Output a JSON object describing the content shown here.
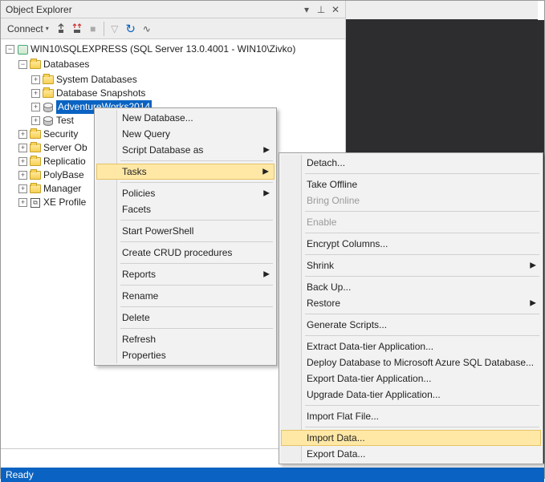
{
  "panel": {
    "title": "Object Explorer",
    "connect_label": "Connect"
  },
  "icons": {
    "window_dropdown": "▾",
    "pin": "📌",
    "close": "✕",
    "refresh": "↻",
    "filter": "▽",
    "pulse": "⁓"
  },
  "tree": {
    "server": "WIN10\\SQLEXPRESS (SQL Server 13.0.4001 - WIN10\\Zivko)",
    "databases": "Databases",
    "system_databases": "System Databases",
    "database_snapshots": "Database Snapshots",
    "adventureworks": "AdventureWorks2014",
    "test": "Test",
    "security": "Security",
    "server_objects": "Server Ob",
    "replication": "Replicatio",
    "polybase": "PolyBase",
    "management": "Manager",
    "xe_profiler": "XE Profile"
  },
  "menu1": {
    "new_database": "New Database...",
    "new_query": "New Query",
    "script_database_as": "Script Database as",
    "tasks": "Tasks",
    "policies": "Policies",
    "facets": "Facets",
    "start_powershell": "Start PowerShell",
    "create_crud": "Create CRUD procedures",
    "reports": "Reports",
    "rename": "Rename",
    "delete": "Delete",
    "refresh": "Refresh",
    "properties": "Properties"
  },
  "menu2": {
    "detach": "Detach...",
    "take_offline": "Take Offline",
    "bring_online": "Bring Online",
    "enable": "Enable",
    "encrypt_columns": "Encrypt Columns...",
    "shrink": "Shrink",
    "back_up": "Back Up...",
    "restore": "Restore",
    "generate_scripts": "Generate Scripts...",
    "extract_dta": "Extract Data-tier Application...",
    "deploy_azure": "Deploy Database to Microsoft Azure SQL Database...",
    "export_dta": "Export Data-tier Application...",
    "upgrade_dta": "Upgrade Data-tier Application...",
    "import_flat": "Import Flat File...",
    "import_data": "Import Data...",
    "export_data": "Export Data..."
  },
  "status": {
    "ready": "Ready"
  }
}
